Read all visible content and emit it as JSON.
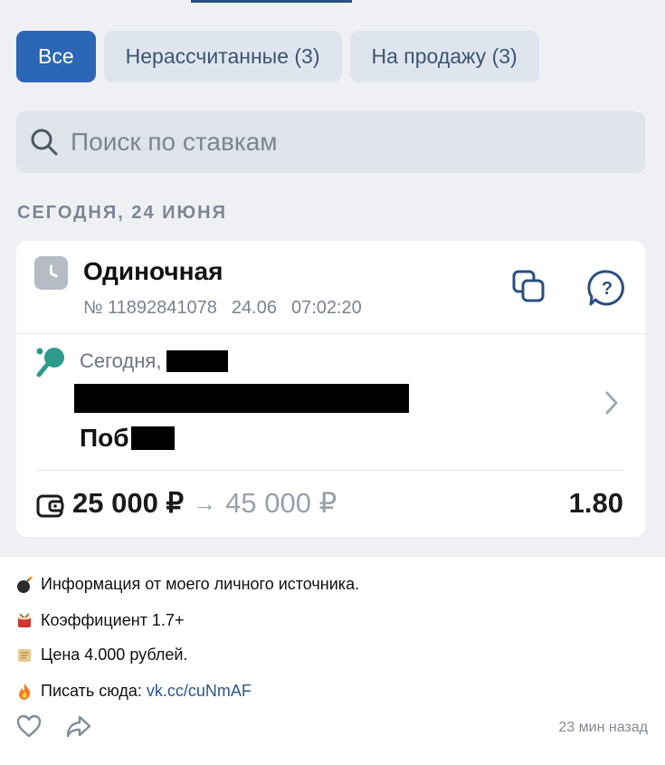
{
  "tabs": [
    {
      "label": "Все"
    },
    {
      "label": "Нерассчитанные (3)"
    },
    {
      "label": "На продажу (3)"
    }
  ],
  "search": {
    "placeholder": "Поиск по ставкам"
  },
  "date_header": "СЕГОДНЯ, 24 ИЮНЯ",
  "bet": {
    "type": "Одиночная",
    "number": "№ 11892841078",
    "date": "24.06",
    "time": "07:02:20",
    "event_date": "Сегодня,",
    "outcome_prefix": "Поб",
    "stake": "25 000 ₽",
    "arrow": "→",
    "payout": "45 000 ₽",
    "odds": "1.80"
  },
  "post": {
    "line1": "Информация от моего личного источника.",
    "line2": "Коэффициент 1.7+",
    "line3": "Цена 4.000 рублей.",
    "line4_prefix": "Писать сюда: ",
    "line4_link": "vk.cc/cuNmAF",
    "timestamp": "23 мин назад"
  },
  "colors": {
    "accent": "#2b67b5",
    "tab_bg": "#dfe5ee",
    "link": "#2a5885"
  },
  "icons": [
    "search-icon",
    "clock-icon",
    "copy-icon",
    "help-icon",
    "table-tennis-icon",
    "chevron-right-icon",
    "wallet-icon",
    "bomb-icon",
    "drum-icon",
    "scroll-icon",
    "fire-icon",
    "heart-icon",
    "share-icon"
  ]
}
